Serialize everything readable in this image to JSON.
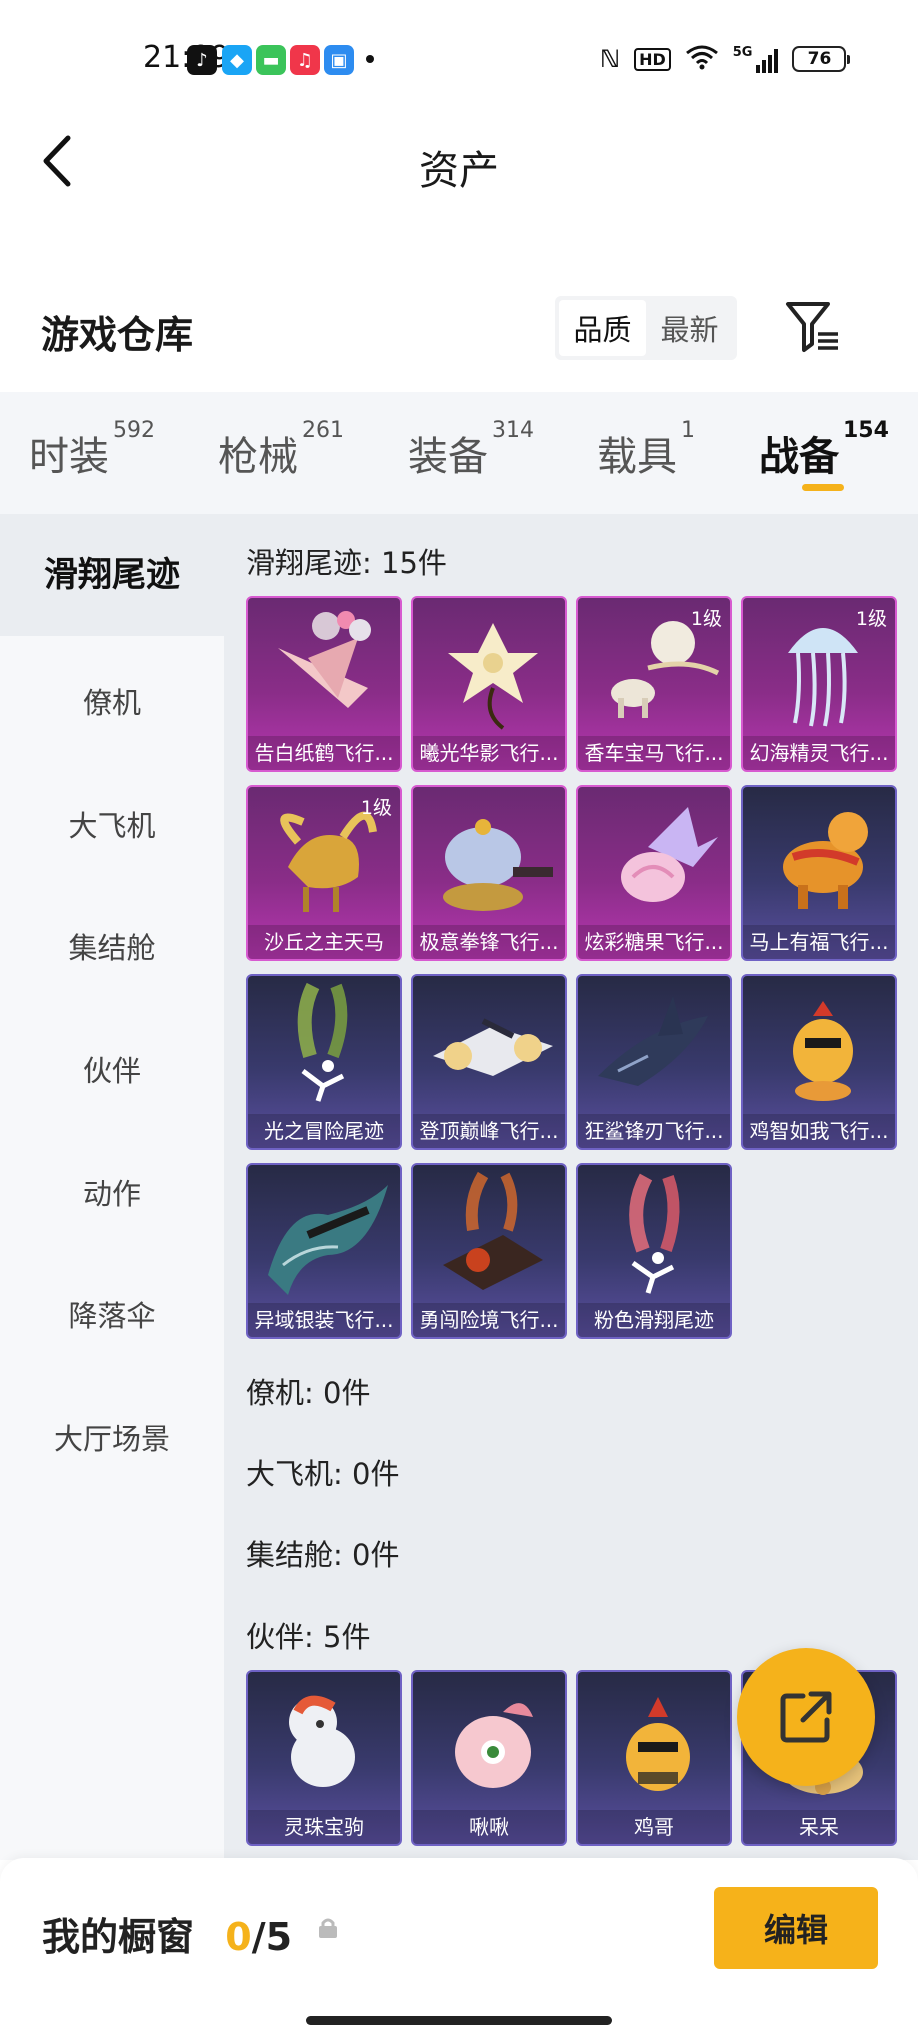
{
  "status_bar": {
    "time": "21:09",
    "battery": "76",
    "network": "5G",
    "hd": "HD"
  },
  "header": {
    "title": "资产"
  },
  "warehouse": {
    "title": "游戏仓库",
    "sort_options": [
      "品质",
      "最新"
    ],
    "active_sort": "品质"
  },
  "tabs": [
    {
      "label": "时装",
      "count": "592"
    },
    {
      "label": "枪械",
      "count": "261"
    },
    {
      "label": "装备",
      "count": "314"
    },
    {
      "label": "载具",
      "count": "1"
    },
    {
      "label": "战备",
      "count": "154"
    }
  ],
  "active_tab": "战备",
  "sidebar": {
    "items": [
      "滑翔尾迹",
      "僚机",
      "大飞机",
      "集结舱",
      "伙伴",
      "动作",
      "降落伞",
      "大厅场景"
    ],
    "active": "滑翔尾迹"
  },
  "groups": {
    "glide": {
      "label": "滑翔尾迹: 15件"
    },
    "wingman": {
      "label": "僚机: 0件"
    },
    "plane": {
      "label": "大飞机: 0件"
    },
    "pod": {
      "label": "集结舱: 0件"
    },
    "partner": {
      "label": "伙伴: 5件"
    }
  },
  "glide_items": [
    {
      "name": "告白纸鹤飞行...",
      "level": "",
      "rarity": "purple",
      "icon": "paper-crane-icon"
    },
    {
      "name": "曦光华影飞行...",
      "level": "",
      "rarity": "purple",
      "icon": "flower-icon"
    },
    {
      "name": "香车宝马飞行...",
      "level": "1级",
      "rarity": "purple",
      "icon": "carriage-icon"
    },
    {
      "name": "幻海精灵飞行...",
      "level": "1级",
      "rarity": "purple",
      "icon": "jellyfish-icon"
    },
    {
      "name": "沙丘之主天马",
      "level": "1级",
      "rarity": "purple",
      "icon": "pegasus-icon"
    },
    {
      "name": "极意拳锋飞行...",
      "level": "",
      "rarity": "purple",
      "icon": "elephant-icon"
    },
    {
      "name": "炫彩糖果飞行...",
      "level": "",
      "rarity": "purple",
      "icon": "candy-icon"
    },
    {
      "name": "马上有福飞行...",
      "level": "",
      "rarity": "blue",
      "icon": "horse-toy-icon"
    },
    {
      "name": "光之冒险尾迹",
      "level": "",
      "rarity": "blue",
      "icon": "green-smoke-icon"
    },
    {
      "name": "登顶巅峰飞行...",
      "level": "",
      "rarity": "blue",
      "icon": "jet-icon"
    },
    {
      "name": "狂鲨锋刃飞行...",
      "level": "",
      "rarity": "blue",
      "icon": "shark-icon"
    },
    {
      "name": "鸡智如我飞行...",
      "level": "",
      "rarity": "blue",
      "icon": "chicken-icon"
    },
    {
      "name": "异域银装飞行...",
      "level": "",
      "rarity": "blue",
      "icon": "wing-glider-icon"
    },
    {
      "name": "勇闯险境飞行...",
      "level": "",
      "rarity": "blue",
      "icon": "rocket-icon"
    },
    {
      "name": "粉色滑翔尾迹",
      "level": "",
      "rarity": "blue",
      "icon": "pink-smoke-icon"
    }
  ],
  "partner_items": [
    {
      "name": "灵珠宝驹",
      "icon": "pony-icon"
    },
    {
      "name": "啾啾",
      "icon": "bird-icon"
    },
    {
      "name": "鸡哥",
      "icon": "rooster-icon"
    },
    {
      "name": "呆呆",
      "icon": "pet-icon"
    }
  ],
  "showcase": {
    "title": "我的橱窗",
    "current": "0",
    "total": "/5",
    "edit_label": "编辑"
  },
  "colors": {
    "accent": "#f5b21b",
    "purple_card": "#8a2d88",
    "blue_card": "#393a6d"
  }
}
